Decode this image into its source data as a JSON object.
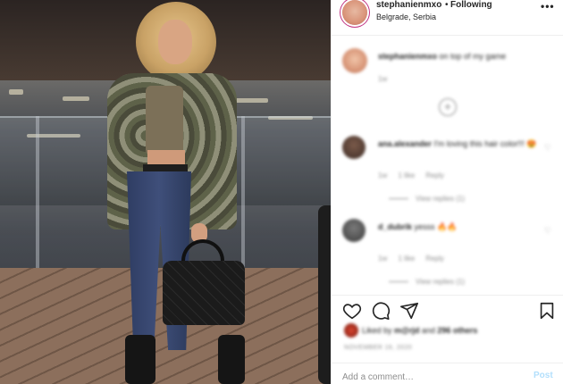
{
  "post": {
    "username": "stephanienmxo",
    "separator": "•",
    "follow_label": "Following",
    "location": "Belgrade, Serbia",
    "more_icon": "more-horizontal-icon"
  },
  "caption": {
    "username": "stephanienmxo",
    "text": "on top of my game",
    "time": "1w"
  },
  "load_more": {
    "icon": "plus-circle-icon",
    "symbol": "+"
  },
  "comments": [
    {
      "username": "ana.alexander",
      "text": "I'm loving this hair color!!! 😍",
      "time": "1w",
      "likes": "1 like",
      "reply": "Reply",
      "view_replies": "View replies (1)"
    },
    {
      "username": "d_dubrik",
      "text": "yesss 🔥🔥",
      "time": "1w",
      "likes": "1 like",
      "reply": "Reply",
      "view_replies": "View replies (1)"
    }
  ],
  "actions": {
    "like_icon": "heart-icon",
    "comment_icon": "comment-icon",
    "share_icon": "paper-plane-icon",
    "save_icon": "bookmark-icon"
  },
  "likes": {
    "prefix": "Liked by",
    "user": "m@rjd",
    "and": "and",
    "others": "296 others"
  },
  "date": "NOVEMBER 16, 2020",
  "comment_box": {
    "placeholder": "Add a comment…",
    "post_label": "Post"
  },
  "colors": {
    "accent": "#0095f6",
    "post_disabled": "#b2dffc",
    "muted": "#8e8e8e",
    "text": "#262626"
  }
}
